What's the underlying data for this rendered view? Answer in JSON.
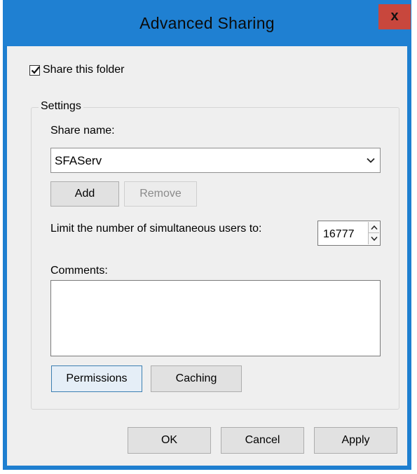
{
  "window": {
    "title": "Advanced Sharing",
    "close_label": "x"
  },
  "share_folder": {
    "label": "Share this folder",
    "checked": true
  },
  "settings": {
    "group_label": "Settings",
    "share_name_label": "Share name:",
    "share_name_value": "SFAServ",
    "add_label": "Add",
    "remove_label": "Remove",
    "limit_label": "Limit the number of simultaneous users to:",
    "limit_value": "16777",
    "comments_label": "Comments:",
    "comments_value": "",
    "permissions_label": "Permissions",
    "caching_label": "Caching"
  },
  "footer": {
    "ok_label": "OK",
    "cancel_label": "Cancel",
    "apply_label": "Apply"
  },
  "colors": {
    "titlebar": "#1f80d2",
    "close": "#c8473d",
    "dialog_bg": "#efefef"
  },
  "icons": {
    "check": "check-icon",
    "dropdown": "chevron-down-icon",
    "spin_up": "chevron-up-icon",
    "spin_down": "chevron-down-icon"
  }
}
